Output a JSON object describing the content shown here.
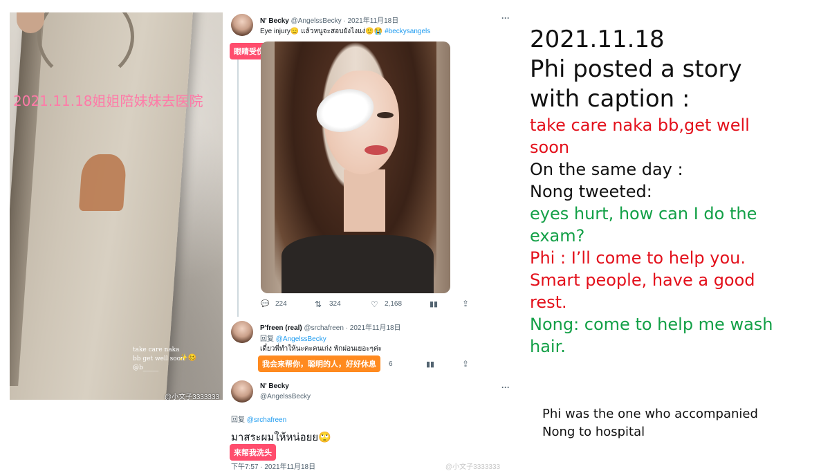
{
  "story": {
    "caption": "2021.11.18姐姐陪妹妹去医院",
    "handwritten": "take care naka bb get well soon",
    "handwritten_extra": "@b_____",
    "watermark": "@小文子3333333"
  },
  "tweet1": {
    "name": "N' Becky",
    "handle": "@AngelssBecky",
    "date": "· 2021年11月18日",
    "text_prefix": "Eye injury😑 แล้วหนูจะสอบยังไงแง่🙂😭",
    "hashtag": "#beckysangels",
    "tag": "眼睛受伤 我要怎么考试",
    "replies": "224",
    "retweets": "324",
    "likes": "2,168"
  },
  "tweet2": {
    "name": "P'freen (real)",
    "handle": "@srchafreen",
    "date": "· 2021年11月18日",
    "reply_prefix": "回复",
    "reply_to": "@AngelssBecky",
    "text": "เดี๋ยวพี่ทำให้นะคะคนเก่ง พักผ่อนเยอะๆค่ะ",
    "tag": "我会来帮你，聪明的人，好好休息",
    "tag_tail": "6"
  },
  "tweet3": {
    "name": "N' Becky",
    "handle": "@AngelssBecky",
    "reply_prefix": "回复",
    "reply_to": "@srchafreen",
    "text": "มาสระผมให้หน่อยย🙄",
    "tag": "来帮我洗头",
    "time": "下午7:57 · 2021年11月18日",
    "watermark": "@小文子3333333"
  },
  "notes": {
    "date": "2021.11.18",
    "l1": "Phi posted a story",
    "l2": "with caption :",
    "l3": "take care naka bb,get well",
    "l4": "soon",
    "l5": "On the same day :",
    "l6": "Nong tweeted:",
    "l7": "eyes hurt, how can I do the",
    "l8": "exam?",
    "l9": "Phi : I’ll come to help you.",
    "l10": "Smart people, have a good",
    "l11": "rest.",
    "l12": "Nong: come to help me wash",
    "l13": "hair."
  },
  "footnote": {
    "l1": "Phi was the one who accompanied",
    "l2": "Nong to hospital"
  },
  "colors": {
    "red": "#e3101b",
    "green": "#13a047",
    "tag_red": "#ff4d6d",
    "tag_orange": "#ff8a1f",
    "twitter_blue": "#1d9bf0"
  }
}
